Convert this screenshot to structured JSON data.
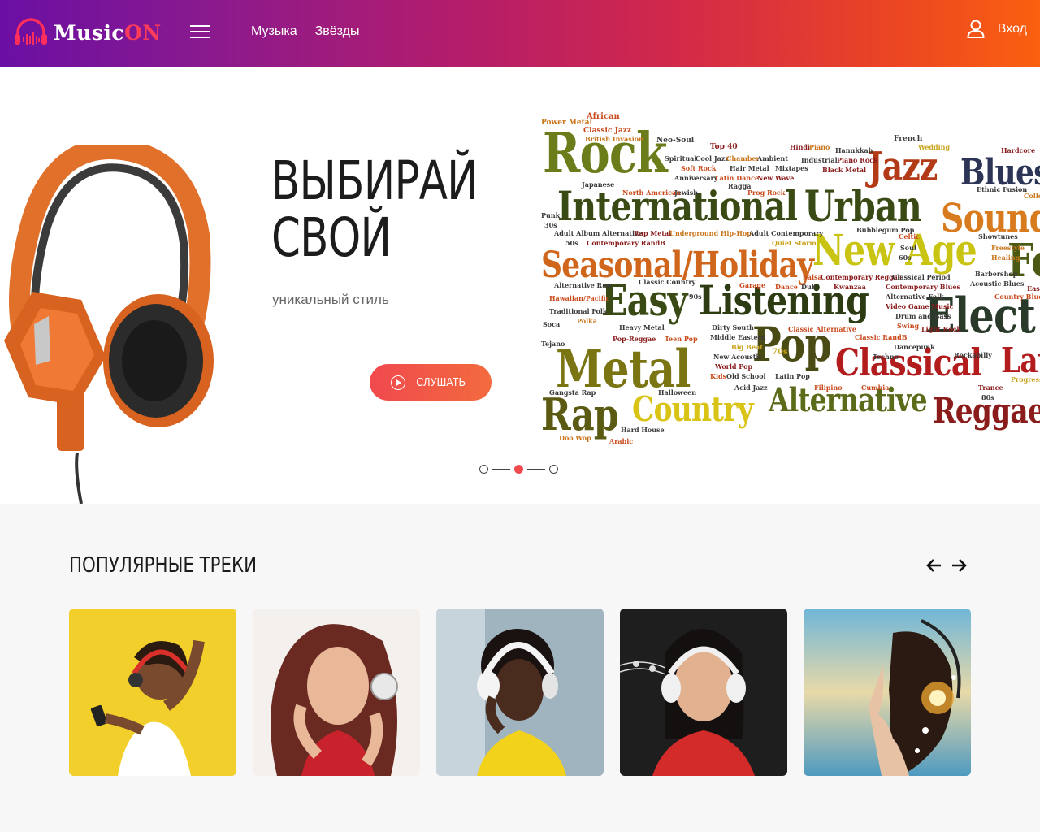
{
  "header": {
    "logo": {
      "main": "Music",
      "accent": "ON"
    },
    "nav": [
      {
        "label": "Музыка"
      },
      {
        "label": "Звёзды"
      }
    ],
    "login_label": "Вход",
    "icons": {
      "menu": "hamburger-icon",
      "user": "user-icon",
      "logo": "headphones-logo-icon"
    }
  },
  "hero": {
    "title_line1": "ВЫБИРАЙ",
    "title_line2": "СВОЙ",
    "subtitle": "уникальный стиль",
    "button_label": "СЛУШАТЬ",
    "slider": {
      "total": 3,
      "active": 2
    },
    "word_cloud": [
      {
        "w": "Rock",
        "c": "#6b7d1a"
      },
      {
        "w": "Jazz",
        "c": "#b23a17"
      },
      {
        "w": "Blues",
        "c": "#2c3555"
      },
      {
        "w": "International",
        "c": "#3a4a14"
      },
      {
        "w": "Urban",
        "c": "#3a4a14"
      },
      {
        "w": "Sound",
        "c": "#d87b1e"
      },
      {
        "w": "Seasonal/Holiday",
        "c": "#d0651c"
      },
      {
        "w": "New Age",
        "c": "#c9c412"
      },
      {
        "w": "Fo",
        "c": "#4a5a14"
      },
      {
        "w": "Easy",
        "c": "#3a4a14"
      },
      {
        "w": "Listening",
        "c": "#2c3b12"
      },
      {
        "w": "Elect",
        "c": "#2a3a2a"
      },
      {
        "w": "Metal",
        "c": "#7a7412"
      },
      {
        "w": "Pop",
        "c": "#4a4a14"
      },
      {
        "w": "Classical",
        "c": "#b21c1c"
      },
      {
        "w": "Lat",
        "c": "#b21c1c"
      },
      {
        "w": "Rap",
        "c": "#5a5a12"
      },
      {
        "w": "Country",
        "c": "#d9c314"
      },
      {
        "w": "Alternative",
        "c": "#5a6b1a"
      },
      {
        "w": "Reggae",
        "c": "#8a1c1c"
      },
      {
        "w": "African",
        "c": "#c94a1c"
      },
      {
        "w": "Power Metal",
        "c": "#c9761c"
      },
      {
        "w": "Classic Jazz",
        "c": "#c94a1c"
      },
      {
        "w": "British Invasion",
        "c": "#c9761c"
      },
      {
        "w": "Neo-Soul",
        "c": "#3a3a3a"
      },
      {
        "w": "Top 40",
        "c": "#8a1c1c"
      },
      {
        "w": "French",
        "c": "#3a3a3a"
      },
      {
        "w": "Wedding",
        "c": "#c9a31c"
      },
      {
        "w": "Hardcore",
        "c": "#8a1c1c"
      },
      {
        "w": "Spiritual",
        "c": "#3a3a3a"
      },
      {
        "w": "Cool Jazz",
        "c": "#3a3a3a"
      },
      {
        "w": "Chamber",
        "c": "#c9761c"
      },
      {
        "w": "Ambient",
        "c": "#3a3a3a"
      },
      {
        "w": "Hindi",
        "c": "#8a1c1c"
      },
      {
        "w": "Piano",
        "c": "#c9761c"
      },
      {
        "w": "Hanukkah",
        "c": "#3a3a3a"
      },
      {
        "w": "Industrial",
        "c": "#3a3a3a"
      },
      {
        "w": "Piano Rock",
        "c": "#8a1c1c"
      },
      {
        "w": "Soft Rock",
        "c": "#c94a1c"
      },
      {
        "w": "Hair Metal",
        "c": "#3a3a3a"
      },
      {
        "w": "Mixtapes",
        "c": "#3a3a3a"
      },
      {
        "w": "Black Metal",
        "c": "#8a1c1c"
      },
      {
        "w": "Anniversary",
        "c": "#3a3a3a"
      },
      {
        "w": "Latin Dance",
        "c": "#c94a1c"
      },
      {
        "w": "New Wave",
        "c": "#8a1c1c"
      },
      {
        "w": "Japanese",
        "c": "#3a3a3a"
      },
      {
        "w": "Ragga",
        "c": "#3a3a3a"
      },
      {
        "w": "North American",
        "c": "#c94a1c"
      },
      {
        "w": "Jewish",
        "c": "#3a3a3a"
      },
      {
        "w": "Prog Rock",
        "c": "#c94a1c"
      },
      {
        "w": "Ethnic Fusion",
        "c": "#3a3a3a"
      },
      {
        "w": "College",
        "c": "#c9761c"
      },
      {
        "w": "Punk",
        "c": "#3a3a3a"
      },
      {
        "w": "30s",
        "c": "#3a3a3a"
      },
      {
        "w": "Adult Album Alternative",
        "c": "#3a3a3a"
      },
      {
        "w": "Rap Metal",
        "c": "#8a1c1c"
      },
      {
        "w": "Underground Hip-Hop",
        "c": "#c9761c"
      },
      {
        "w": "Adult Contemporary",
        "c": "#3a3a3a"
      },
      {
        "w": "Bubblegum Pop",
        "c": "#3a3a3a"
      },
      {
        "w": "Showtunes",
        "c": "#3a3a3a"
      },
      {
        "w": "50s",
        "c": "#3a3a3a"
      },
      {
        "w": "Contemporary RandB",
        "c": "#8a1c1c"
      },
      {
        "w": "Quiet Storm",
        "c": "#c9a31c"
      },
      {
        "w": "Celtic",
        "c": "#c94a1c"
      },
      {
        "w": "Freestyle",
        "c": "#c9761c"
      },
      {
        "w": "Soul",
        "c": "#3a3a3a"
      },
      {
        "w": "60s",
        "c": "#3a3a3a"
      },
      {
        "w": "Healing",
        "c": "#c9761c"
      },
      {
        "w": "Salsa",
        "c": "#c94a1c"
      },
      {
        "w": "Contemporary Reggae",
        "c": "#8a1c1c"
      },
      {
        "w": "Classical Period",
        "c": "#3a3a3a"
      },
      {
        "w": "Barbershop",
        "c": "#3a3a3a"
      },
      {
        "w": "Alternative Rap",
        "c": "#3a3a3a"
      },
      {
        "w": "Classic Country",
        "c": "#3a3a3a"
      },
      {
        "w": "Garage",
        "c": "#c94a1c"
      },
      {
        "w": "Dance",
        "c": "#c94a1c"
      },
      {
        "w": "Dub",
        "c": "#3a3a3a"
      },
      {
        "w": "Kwanzaa",
        "c": "#8a1c1c"
      },
      {
        "w": "Contemporary Blues",
        "c": "#8a1c1c"
      },
      {
        "w": "Acoustic Blues",
        "c": "#3a3a3a"
      },
      {
        "w": "East Co",
        "c": "#8a1c1c"
      },
      {
        "w": "Hawaiian/Pacific",
        "c": "#c94a1c"
      },
      {
        "w": "90s",
        "c": "#3a3a3a"
      },
      {
        "w": "Alternative Folk",
        "c": "#3a3a3a"
      },
      {
        "w": "Country Blues",
        "c": "#c94a1c"
      },
      {
        "w": "Video Game Music",
        "c": "#8a1c1c"
      },
      {
        "w": "Traditional Folk",
        "c": "#3a3a3a"
      },
      {
        "w": "Drum and Bass",
        "c": "#3a3a3a"
      },
      {
        "w": "Polka",
        "c": "#c9761c"
      },
      {
        "w": "Soca",
        "c": "#3a3a3a"
      },
      {
        "w": "Heavy Metal",
        "c": "#3a3a3a"
      },
      {
        "w": "Dirty South",
        "c": "#3a3a3a"
      },
      {
        "w": "Classic Alternative",
        "c": "#c94a1c"
      },
      {
        "w": "Swing",
        "c": "#c94a1c"
      },
      {
        "w": "Light Rock",
        "c": "#8a1c1c"
      },
      {
        "w": "Pop-Reggae",
        "c": "#8a1c1c"
      },
      {
        "w": "Teen Pop",
        "c": "#c94a1c"
      },
      {
        "w": "Middle Eastern",
        "c": "#3a3a3a"
      },
      {
        "w": "Classic RandB",
        "c": "#c94a1c"
      },
      {
        "w": "Tejano",
        "c": "#3a3a3a"
      },
      {
        "w": "Big Beat",
        "c": "#c9a31c"
      },
      {
        "w": "Dancepunk",
        "c": "#3a3a3a"
      },
      {
        "w": "New Acoustic",
        "c": "#3a3a3a"
      },
      {
        "w": "70s",
        "c": "#c9a31c"
      },
      {
        "w": "Techno",
        "c": "#3a3a3a"
      },
      {
        "w": "Rockabilly",
        "c": "#3a3a3a"
      },
      {
        "w": "World Pop",
        "c": "#8a1c1c"
      },
      {
        "w": "Kids",
        "c": "#c94a1c"
      },
      {
        "w": "Old School",
        "c": "#3a3a3a"
      },
      {
        "w": "Latin Pop",
        "c": "#3a3a3a"
      },
      {
        "w": "Progressive",
        "c": "#c9a31c"
      },
      {
        "w": "Acid Jazz",
        "c": "#3a3a3a"
      },
      {
        "w": "Filipino",
        "c": "#c94a1c"
      },
      {
        "w": "Cumbia",
        "c": "#c94a1c"
      },
      {
        "w": "Trance",
        "c": "#8a1c1c"
      },
      {
        "w": "Gangsta Rap",
        "c": "#3a3a3a"
      },
      {
        "w": "Halloween",
        "c": "#3a3a3a"
      },
      {
        "w": "80s",
        "c": "#3a3a3a"
      },
      {
        "w": "Hard House",
        "c": "#3a3a3a"
      },
      {
        "w": "Doo Wop",
        "c": "#c9761c"
      },
      {
        "w": "Arabic",
        "c": "#c94a1c"
      }
    ]
  },
  "popular": {
    "title": "ПОПУЛЯРНЫЕ ТРЕКИ",
    "icons": {
      "prev": "arrow-left-icon",
      "next": "arrow-right-icon"
    },
    "tracks": [
      {
        "image": "woman-yellow-bg-red-headphones"
      },
      {
        "image": "woman-smiling-red-hair-headphones"
      },
      {
        "image": "woman-white-headphones-yellow-top"
      },
      {
        "image": "woman-chalkboard-music-notes"
      },
      {
        "image": "woman-sky-splash-headphones"
      }
    ]
  }
}
